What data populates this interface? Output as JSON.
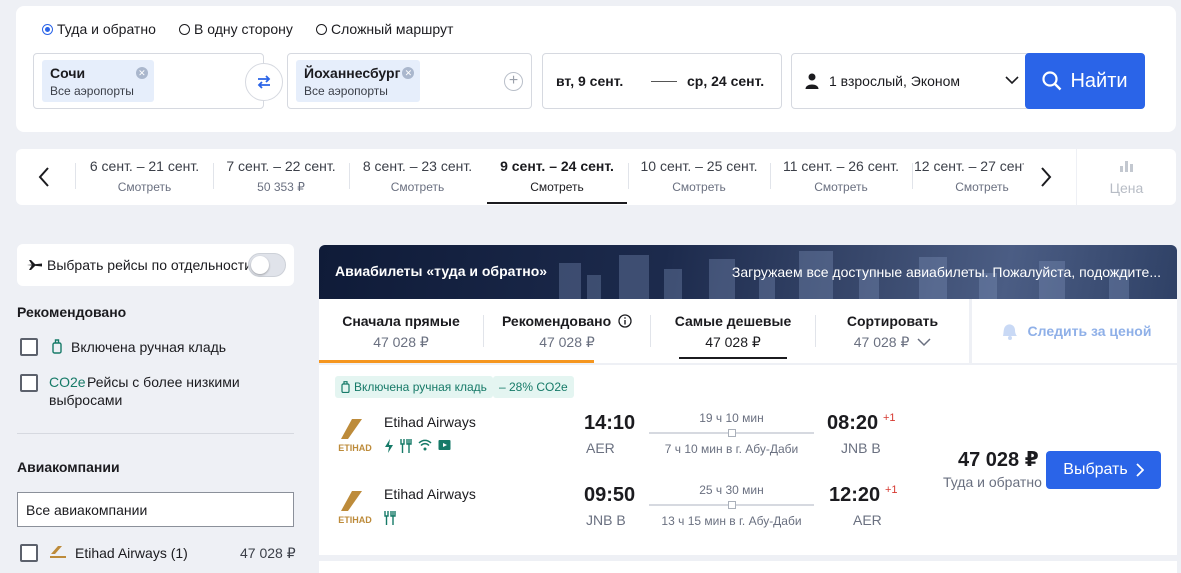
{
  "search": {
    "trip_types": [
      {
        "label": "Туда и обратно",
        "selected": true
      },
      {
        "label": "В одну сторону",
        "selected": false
      },
      {
        "label": "Сложный маршрут",
        "selected": false
      }
    ],
    "origin": {
      "city": "Сочи",
      "sub": "Все аэропорты"
    },
    "destination": {
      "city": "Йоханнесбург",
      "sub": "Все аэропорты"
    },
    "depart_date": "вт, 9 сент.",
    "return_date": "ср, 24 сент.",
    "passengers": "1 взрослый, Эконом",
    "find_label": "Найти",
    "accent_color": "#2a64e8"
  },
  "date_strip": {
    "tabs": [
      {
        "dates": "6 сент. – 21 сент.",
        "price": "Смотреть",
        "selected": false
      },
      {
        "dates": "7 сент. – 22 сент.",
        "price": "50 353 ₽",
        "selected": false
      },
      {
        "dates": "8 сент. – 23 сент.",
        "price": "Смотреть",
        "selected": false
      },
      {
        "dates": "9 сент. – 24 сент.",
        "price": "Смотреть",
        "selected": true
      },
      {
        "dates": "10 сент. – 25 сент.",
        "price": "Смотреть",
        "selected": false
      },
      {
        "dates": "11 сент. – 26 сент.",
        "price": "Смотреть",
        "selected": false
      },
      {
        "dates": "12 сент. – 27 сент.",
        "price": "Смотреть",
        "selected": false
      }
    ],
    "price_chart_label": "Цена"
  },
  "filters": {
    "separate_flights_label": "Выбрать рейсы по отдельности",
    "recommended_heading": "Рекомендовано",
    "hand_luggage_label": "Включена ручная кладь",
    "co2_tag": "CO2e",
    "co2_label_1": "Рейсы с более низкими",
    "co2_label_2": "выбросами",
    "airlines_heading": "Авиакомпании",
    "all_airlines_value": "Все авиакомпании",
    "airline_option": {
      "name": "Etihad Airways (1)",
      "price": "47 028 ₽"
    }
  },
  "results": {
    "banner_title": "Авиабилеты «туда и обратно»",
    "banner_loading": "Загружаем все доступные авиабилеты. Пожалуйста, подождите...",
    "sort_tabs": [
      {
        "label": "Сначала прямые",
        "price": "47 028 ₽"
      },
      {
        "label": "Рекомендовано",
        "price": "47 028 ₽"
      },
      {
        "label": "Самые дешевые",
        "price": "47 028 ₽"
      },
      {
        "label": "Сортировать",
        "price": "47 028 ₽"
      }
    ],
    "watch_price_label": "Следить за ценой",
    "card": {
      "tags": [
        "Включена ручная кладь",
        "– 28% CO2e"
      ],
      "legs": [
        {
          "airline": "Etihad Airways",
          "dep_time": "14:10",
          "dep_code": "AER",
          "duration": "19 ч 10 мин",
          "stop": "7 ч 10 мин в г. Абу-Даби",
          "arr_time": "08:20",
          "day_offset": "+1",
          "arr_code": "JNB B",
          "amenities": [
            "power-icon",
            "meal-icon",
            "wifi-icon",
            "entertainment-icon"
          ]
        },
        {
          "airline": "Etihad Airways",
          "dep_time": "09:50",
          "dep_code": "JNB B",
          "duration": "25 ч 30 мин",
          "stop": "13 ч 15 мин в г. Абу-Даби",
          "arr_time": "12:20",
          "day_offset": "+1",
          "arr_code": "AER",
          "amenities": [
            "meal-icon"
          ]
        }
      ],
      "price": "47 028 ₽",
      "price_sub": "Туда и обратно",
      "select_label": "Выбрать"
    }
  }
}
